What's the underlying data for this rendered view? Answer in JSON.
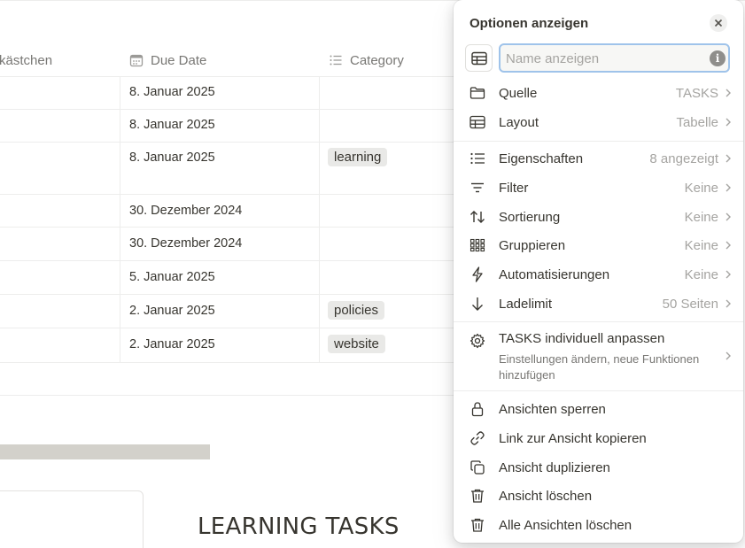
{
  "table": {
    "columns": [
      {
        "label": "kästchen",
        "icon": "checkbox-icon"
      },
      {
        "label": "Due Date",
        "icon": "calendar-icon"
      },
      {
        "label": "Category",
        "icon": "list-icon"
      }
    ],
    "rows": [
      {
        "date": "8. Januar 2025",
        "tag": ""
      },
      {
        "date": "8. Januar 2025",
        "tag": ""
      },
      {
        "date": "8. Januar 2025",
        "tag": "learning"
      },
      {
        "date": "30. Dezember 2024",
        "tag": ""
      },
      {
        "date": "30. Dezember 2024",
        "tag": ""
      },
      {
        "date": "5. Januar 2025",
        "tag": ""
      },
      {
        "date": "2. Januar 2025",
        "tag": "policies"
      },
      {
        "date": "2. Januar 2025",
        "tag": "website"
      }
    ]
  },
  "section_title": "LEARNING TASKS",
  "panel": {
    "title": "Optionen anzeigen",
    "name_input": {
      "placeholder": "Name anzeigen",
      "value": ""
    },
    "group1": [
      {
        "label": "Quelle",
        "value": "TASKS",
        "icon": "folder-icon"
      },
      {
        "label": "Layout",
        "value": "Tabelle",
        "icon": "table-icon"
      }
    ],
    "group2": [
      {
        "label": "Eigenschaften",
        "value": "8 angezeigt",
        "icon": "list-icon"
      },
      {
        "label": "Filter",
        "value": "Keine",
        "icon": "filter-icon"
      },
      {
        "label": "Sortierung",
        "value": "Keine",
        "icon": "sort-icon"
      },
      {
        "label": "Gruppieren",
        "value": "Keine",
        "icon": "group-icon"
      },
      {
        "label": "Automatisierungen",
        "value": "Keine",
        "icon": "lightning-icon"
      },
      {
        "label": "Ladelimit",
        "value": "50 Seiten",
        "icon": "arrow-down-icon"
      }
    ],
    "customize": {
      "label": "TASKS individuell anpassen",
      "description": "Einstellungen ändern, neue Funktionen hinzufügen",
      "icon": "gear-icon"
    },
    "group3": [
      {
        "label": "Ansichten sperren",
        "icon": "lock-icon"
      },
      {
        "label": "Link zur Ansicht kopieren",
        "icon": "link-icon"
      },
      {
        "label": "Ansicht duplizieren",
        "icon": "duplicate-icon"
      },
      {
        "label": "Ansicht löschen",
        "icon": "trash-icon"
      },
      {
        "label": "Alle Ansichten löschen",
        "icon": "trash-icon"
      }
    ]
  }
}
